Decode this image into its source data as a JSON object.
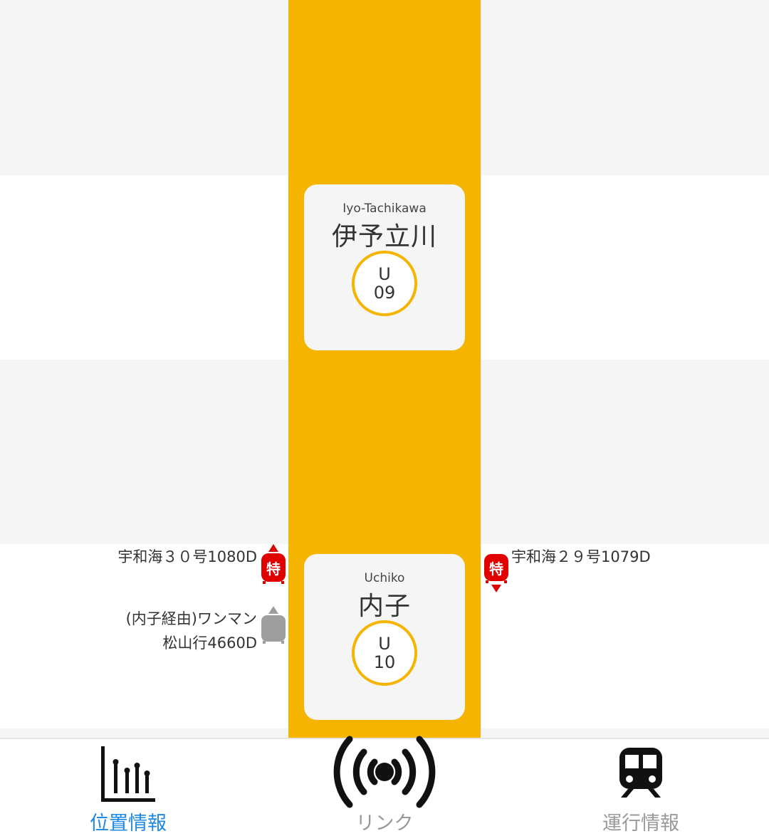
{
  "colors": {
    "line": "#f5b400",
    "active_tab": "#1e88e5",
    "inactive_tab": "#999999",
    "limited_express": "#e00000",
    "local_train": "#9e9e9e"
  },
  "stations": [
    {
      "name_en": "Iyo-Tachikawa",
      "name_ja": "伊予立川",
      "code_letter": "U",
      "code_number": "09"
    },
    {
      "name_en": "Uchiko",
      "name_ja": "内子",
      "code_letter": "U",
      "code_number": "10"
    }
  ],
  "trains": {
    "up_limited": {
      "label": "宇和海３０号1080D",
      "badge": "特",
      "icon": "limited-express-up-icon"
    },
    "down_limited": {
      "label": "宇和海２９号1079D",
      "badge": "特",
      "icon": "limited-express-down-icon"
    },
    "up_local": {
      "line1": "(内子経由)ワンマン",
      "line2": "松山行4660D",
      "icon": "local-train-up-icon"
    }
  },
  "nav": {
    "items": [
      {
        "label": "位置情報",
        "icon": "position-chart-icon"
      },
      {
        "label": "リンク",
        "icon": "broadcast-icon"
      },
      {
        "label": "運行情報",
        "icon": "train-icon"
      }
    ]
  }
}
